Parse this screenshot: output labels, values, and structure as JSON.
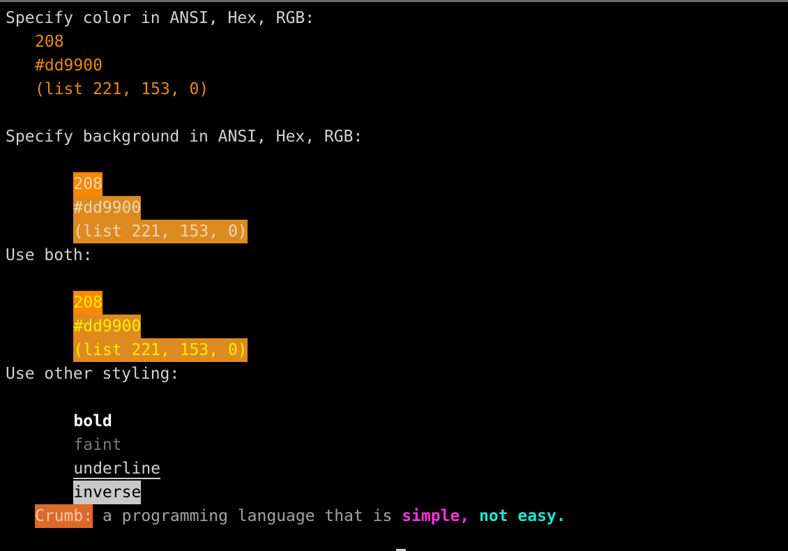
{
  "terminal": {
    "sections": {
      "color": {
        "heading": "Specify color in ANSI, Hex, RGB:",
        "ansi": "208",
        "hex": "#dd9900",
        "rgb": "(list 221, 153, 0)"
      },
      "background": {
        "heading": "Specify background in ANSI, Hex, RGB:",
        "ansi": "208",
        "hex": "#dd9900",
        "rgb": "(list 221, 153, 0)"
      },
      "both": {
        "heading": "Use both:",
        "ansi": "208",
        "hex": "#dd9900",
        "rgb": "(list 221, 153, 0)"
      },
      "styling": {
        "heading": "Use other styling:",
        "bold": "bold",
        "faint": "faint",
        "underline": "underline",
        "inverse": "inverse"
      },
      "tagline": {
        "brand": "Crumb:",
        "text": " a programming language that is ",
        "simple": "simple,",
        "space": " ",
        "not_easy": "not easy."
      }
    },
    "colors": {
      "background": "#000000",
      "text": "#d2d2d2",
      "orange": "#e98a12",
      "ansi_208_bg": "#ff8700",
      "hex_bg": "#dd8a1f",
      "yellow": "#ffee00",
      "magenta": "#ff33dd",
      "cyan": "#1fe6d4"
    }
  }
}
